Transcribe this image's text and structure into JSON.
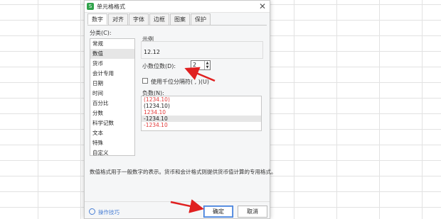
{
  "dialog": {
    "title": "单元格格式",
    "app_icon": "S",
    "close": "✕"
  },
  "tabs": [
    "数字",
    "对齐",
    "字体",
    "边框",
    "图案",
    "保护"
  ],
  "category_label": "分类(C):",
  "categories": [
    "常规",
    "数值",
    "货币",
    "会计专用",
    "日期",
    "时间",
    "百分比",
    "分数",
    "科学记数",
    "文本",
    "特殊",
    "自定义"
  ],
  "selected_category": "数值",
  "sample": {
    "label": "示例",
    "value": "12.12"
  },
  "decimal_places": {
    "label": "小数位数(D):",
    "value": "2",
    "up": "▲",
    "down": "▼"
  },
  "thousands_separator": {
    "label": "使用千位分隔符( , )(U)",
    "checked": false
  },
  "negative_numbers": {
    "label": "负数(N):",
    "items": [
      {
        "text": "(1234.10)",
        "color": "#e23b3b"
      },
      {
        "text": "(1234.10)",
        "color": "#222222"
      },
      {
        "text": "1234.10",
        "color": "#e23b3b"
      },
      {
        "text": "-1234.10",
        "color": "#222222",
        "selected": true
      },
      {
        "text": "-1234.10",
        "color": "#e23b3b"
      }
    ]
  },
  "description": "数值格式用于一般数字的表示。货币和会计格式则提供货币值计算的专用格式。",
  "footer": {
    "tips_label": "操作技巧",
    "ok_label": "确定",
    "cancel_label": "取消"
  },
  "annotations": {
    "arrow_color": "#e02020"
  }
}
